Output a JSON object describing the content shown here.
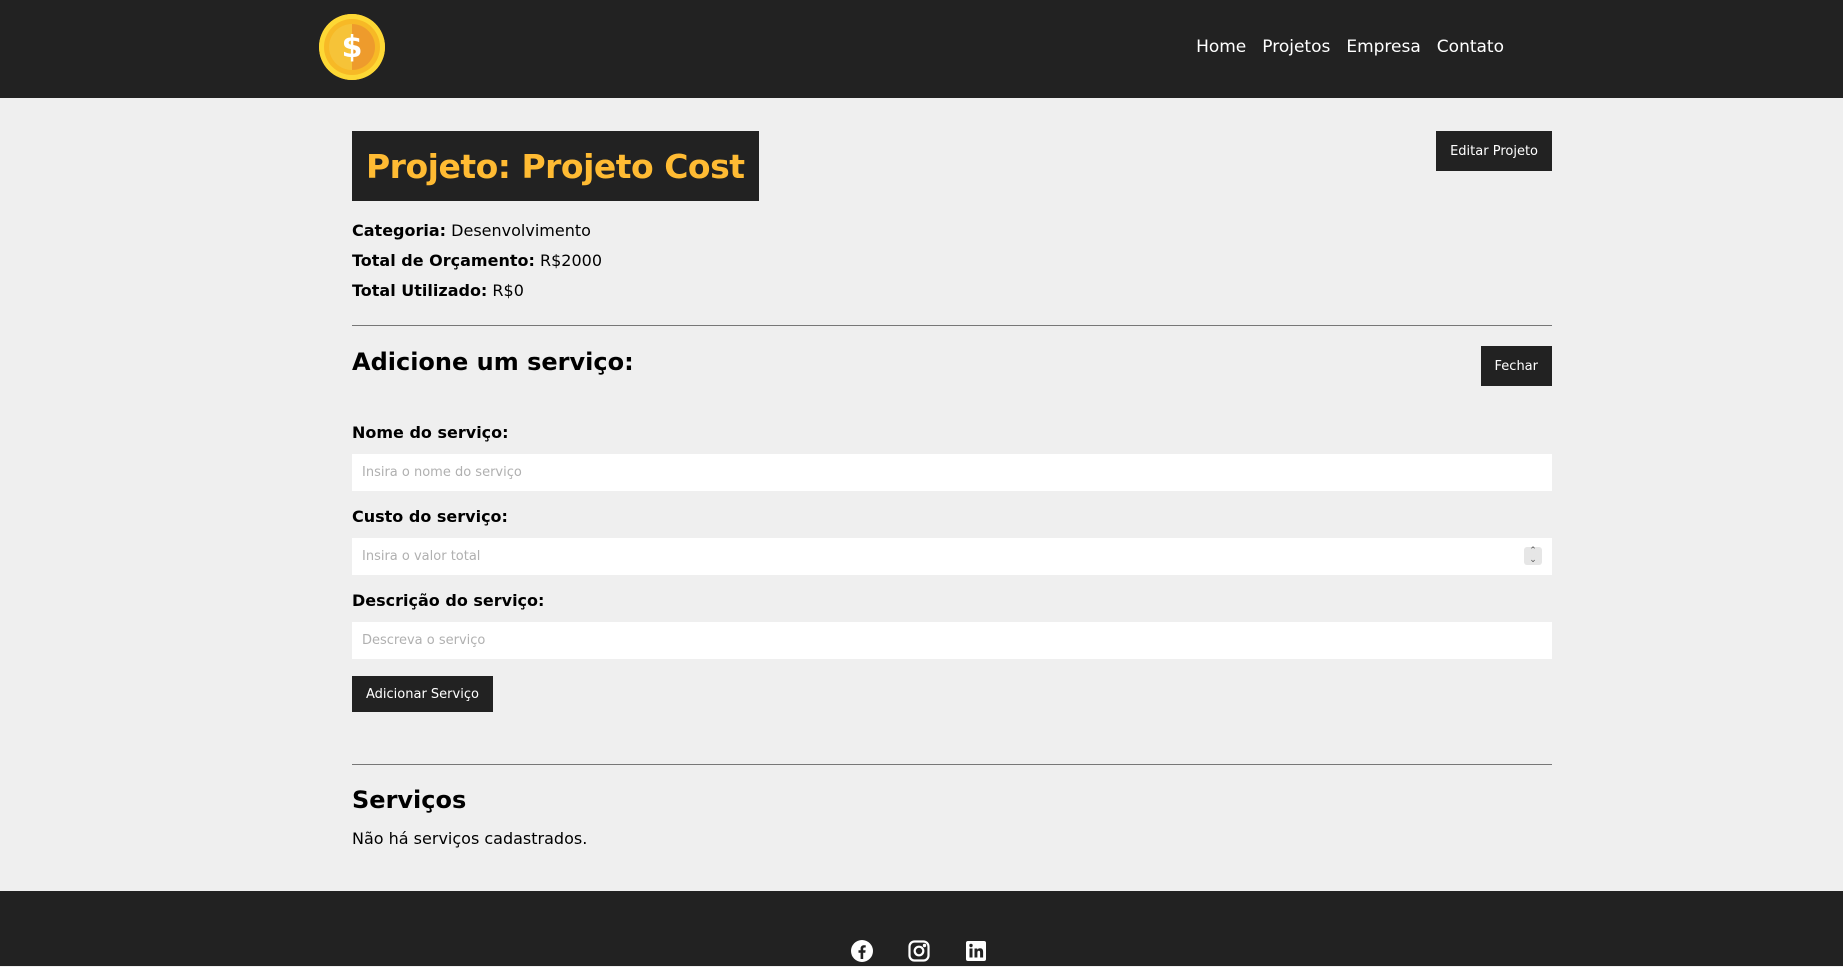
{
  "header": {
    "logo_symbol": "$",
    "nav": [
      "Home",
      "Projetos",
      "Empresa",
      "Contato"
    ]
  },
  "project": {
    "title": "Projeto: Projeto Cost",
    "edit_label": "Editar Projeto",
    "category_label": "Categoria:",
    "category_value": "Desenvolvimento",
    "budget_label": "Total de Orçamento:",
    "budget_value": "R$2000",
    "used_label": "Total Utilizado:",
    "used_value": "R$0"
  },
  "service_form": {
    "title": "Adicione um serviço:",
    "close_label": "Fechar",
    "name_label": "Nome do serviço:",
    "name_placeholder": "Insira o nome do serviço",
    "cost_label": "Custo do serviço:",
    "cost_placeholder": "Insira o valor total",
    "desc_label": "Descrição do serviço:",
    "desc_placeholder": "Descreva o serviço",
    "submit_label": "Adicionar Serviço"
  },
  "services": {
    "title": "Serviços",
    "empty_text": "Não há serviços cadastrados."
  },
  "footer": {
    "social": [
      "facebook-icon",
      "instagram-icon",
      "linkedin-icon"
    ]
  },
  "colors": {
    "dark": "#222222",
    "accent": "#ffbb33",
    "background": "#efefef"
  }
}
